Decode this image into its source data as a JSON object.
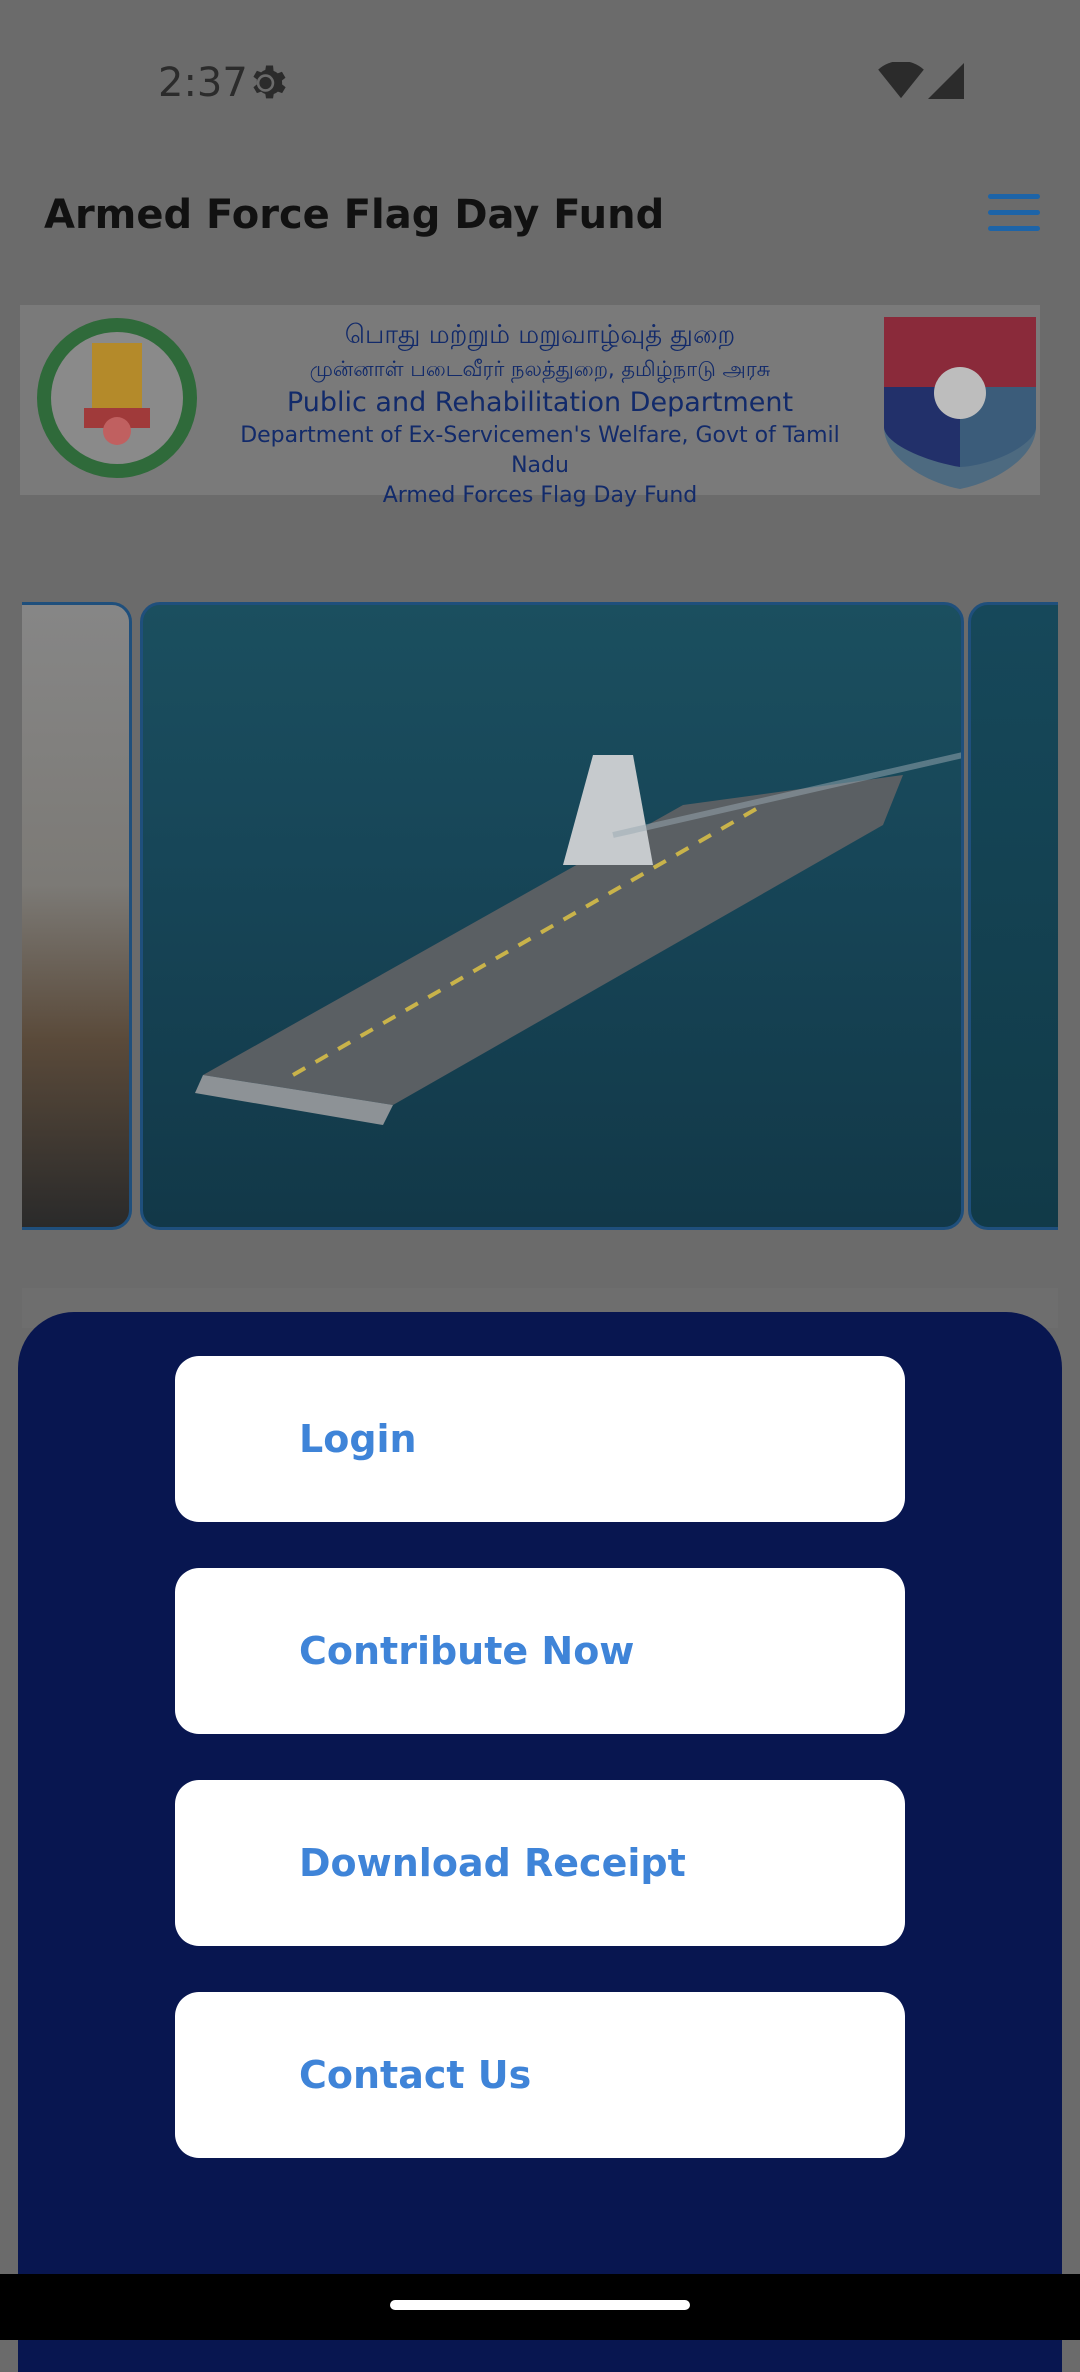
{
  "status_bar": {
    "time": "2:37",
    "settings_icon": "gear-icon",
    "wifi_icon": "wifi-icon",
    "signal_icon": "signal-icon"
  },
  "app_bar": {
    "title": "Armed Force Flag Day Fund",
    "menu_icon": "hamburger-menu-icon"
  },
  "banner": {
    "line_tamil_1": "பொது மற்றும் மறுவாழ்வுத் துறை",
    "line_tamil_2": "முன்னாள் படைவீரர் நலத்துறை, தமிழ்நாடு அரசு",
    "line_en_1": "Public and Rehabilitation Department",
    "line_en_2": "Department of  Ex-Servicemen's  Welfare, Govt of  Tamil Nadu",
    "line_en_3": "Armed Forces Flag Day Fund",
    "left_emblem": "tamil-nadu-emblem-icon",
    "right_emblem": "armed-forces-crest-icon"
  },
  "carousel": {
    "center_slide": "aircraft-carrier-image"
  },
  "actions": {
    "login": "Login",
    "contribute": "Contribute Now",
    "download": "Download Receipt",
    "contact": "Contact Us"
  },
  "colors": {
    "panel": "#081650",
    "button_text": "#3f84d8",
    "menu": "#1d64a8"
  }
}
